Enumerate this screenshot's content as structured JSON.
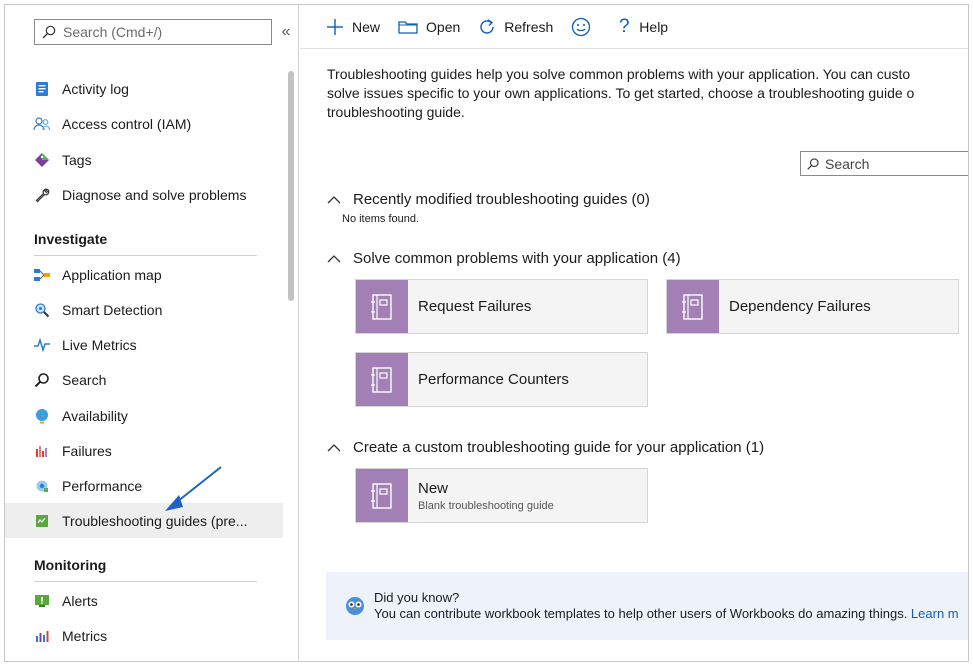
{
  "sidebar": {
    "search_placeholder": "Search (Cmd+/)",
    "collapse_glyph": "«",
    "items_top": [
      {
        "label": "Activity log",
        "icon": "activity-log-icon"
      },
      {
        "label": "Access control (IAM)",
        "icon": "access-control-icon"
      },
      {
        "label": "Tags",
        "icon": "tag-icon"
      },
      {
        "label": "Diagnose and solve problems",
        "icon": "wrench-icon"
      }
    ],
    "investigate_title": "Investigate",
    "investigate_items": [
      {
        "label": "Application map",
        "icon": "application-map-icon"
      },
      {
        "label": "Smart Detection",
        "icon": "smart-detection-icon"
      },
      {
        "label": "Live Metrics",
        "icon": "live-metrics-icon"
      },
      {
        "label": "Search",
        "icon": "search-icon"
      },
      {
        "label": "Availability",
        "icon": "globe-icon"
      },
      {
        "label": "Failures",
        "icon": "failures-icon"
      },
      {
        "label": "Performance",
        "icon": "performance-icon"
      },
      {
        "label": "Troubleshooting guides (pre...",
        "icon": "troubleshooting-guide-icon",
        "active": true
      }
    ],
    "monitoring_title": "Monitoring",
    "monitoring_items": [
      {
        "label": "Alerts",
        "icon": "alert-icon"
      },
      {
        "label": "Metrics",
        "icon": "metrics-icon"
      }
    ]
  },
  "toolbar": {
    "new_label": "New",
    "open_label": "Open",
    "refresh_label": "Refresh",
    "help_label": "Help"
  },
  "intro": {
    "line1": "Troubleshooting guides help you solve common problems with your application. You can custo",
    "line2": "solve issues specific to your own applications. To get started, choose a troubleshooting guide o",
    "line3": "troubleshooting guide."
  },
  "content_search": {
    "placeholder": "Search"
  },
  "groups": {
    "recent": {
      "title": "Recently modified troubleshooting guides (0)",
      "empty": "No items found."
    },
    "common": {
      "title": "Solve common problems with your application (4)"
    },
    "custom": {
      "title": "Create a custom troubleshooting guide for your application (1)"
    }
  },
  "tiles": {
    "request_failures": "Request Failures",
    "dependency_failures": "Dependency Failures",
    "performance_counters": "Performance Counters",
    "new_title": "New",
    "new_subtitle": "Blank troubleshooting guide"
  },
  "tip": {
    "title": "Did you know?",
    "body": "You can contribute workbook templates to help other users of Workbooks do amazing things. ",
    "link": "Learn m"
  },
  "colors": {
    "tile_icon_bg": "#a27fb4",
    "accent_blue": "#0f5fb5",
    "arrow_blue": "#1e62c8"
  }
}
